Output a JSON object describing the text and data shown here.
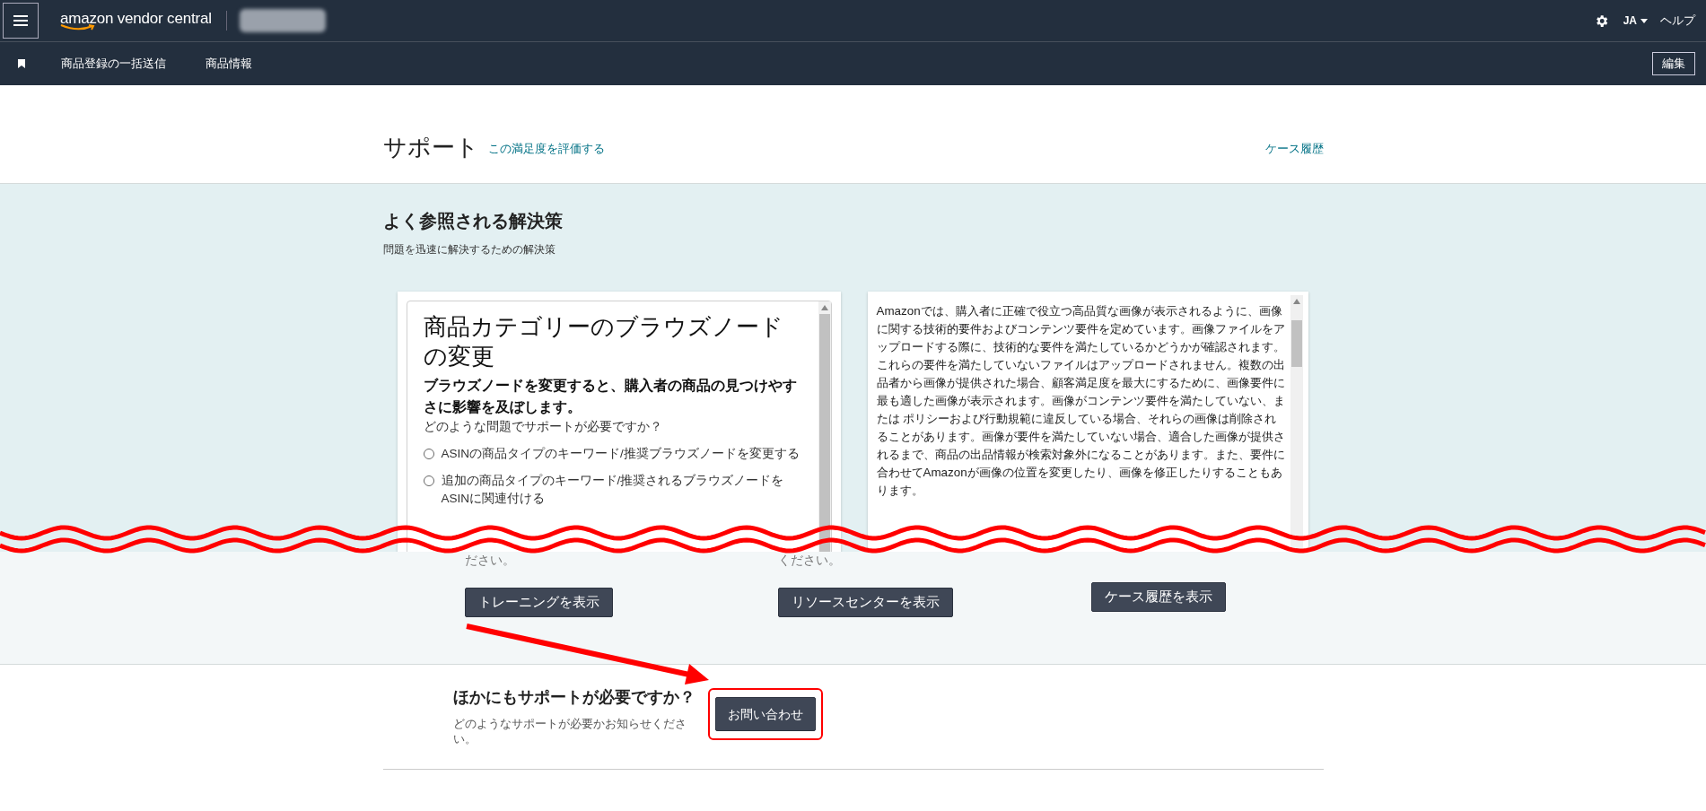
{
  "top_bar": {
    "logo": "amazon vendor central",
    "language": "JA",
    "help": "ヘルプ"
  },
  "nav_bar": {
    "items": [
      {
        "label": "商品登録の一括送信"
      },
      {
        "label": "商品情報"
      }
    ],
    "edit_button": "編集"
  },
  "header": {
    "title": "サポート",
    "rate_link": "この満足度を評価する",
    "case_history_link": "ケース履歴"
  },
  "solutions": {
    "title": "よく参照される解決策",
    "subtitle": "問題を迅速に解決するための解決策",
    "cards": [
      {
        "kind": "question",
        "title": "商品カテゴリーのブラウズノードの変更",
        "lead": "ブラウズノードを変更すると、購入者の商品の見つけやすさに影響を及ぼします。",
        "question": "どのような問題でサポートが必要ですか？",
        "options": [
          {
            "label": "ASINの商品タイプのキーワード/推奨ブラウズノードを変更する",
            "selected": false
          },
          {
            "label": "追加の商品タイプのキーワード/推奨されるブラウズノードをASINに関連付ける",
            "selected": false
          }
        ]
      },
      {
        "kind": "text",
        "body": "Amazonでは、購入者に正確で役立つ高品質な画像が表示されるように、画像に関する技術的要件およびコンテンツ要件を定めています。画像ファイルをアップロードする際に、技術的な要件を満たしているかどうかが確認されます。これらの要件を満たしていないファイルはアップロードされません。複数の出品者から画像が提供された場合、顧客満足度を最大にするために、画像要件に最も適した画像が表示されます。画像がコンテンツ要件を満たしていない、または ポリシーおよび行動規範に違反している場合、それらの画像は削除されることがあります。画像が要件を満たしていない場合、適合した画像が提供されるまで、商品の出品情報が検索対象外になることがあります。また、要件に合わせてAmazonが画像の位置を変更したり、画像を修正したりすることもあります。"
      }
    ],
    "fragments": [
      "ださい。",
      "ください。"
    ],
    "buttons": [
      "トレーニングを表示",
      "リソースセンターを表示",
      "ケース履歴を表示"
    ]
  },
  "more_help": {
    "title": "ほかにもサポートが必要ですか？",
    "text": "どのようなサポートが必要かお知らせください。",
    "button": "お問い合わせ",
    "highlighted": true
  }
}
